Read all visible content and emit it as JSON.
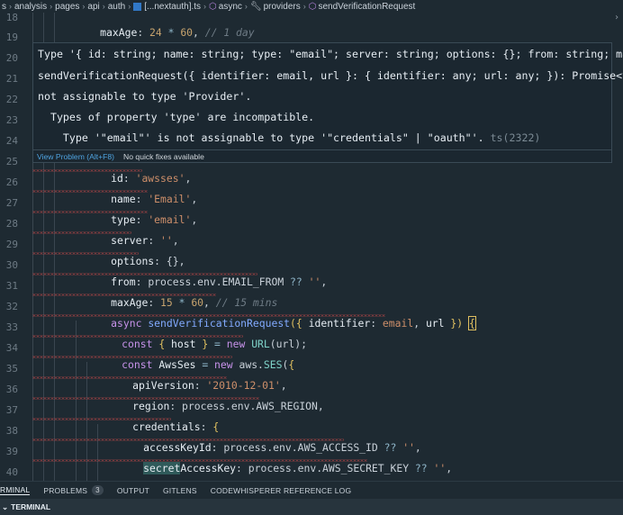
{
  "breadcrumb": {
    "items": [
      "analysis",
      "pages",
      "api",
      "auth",
      "[...nextauth].ts",
      "async",
      "providers",
      "sendVerificationRequest"
    ],
    "first_prefix": "s"
  },
  "editor": {
    "line_numbers": [
      "18",
      "19",
      "20",
      "21",
      "22",
      "23",
      "24",
      "25",
      "26",
      "27",
      "28",
      "29",
      "30",
      "31",
      "32",
      "33",
      "34",
      "35",
      "36",
      "37",
      "38",
      "39",
      "40"
    ],
    "top_line": {
      "prop": "maxAge",
      "rest_a": ": ",
      "n1": "24",
      "op1": " * ",
      "n2": "60",
      "comma": ", ",
      "comment": "// 1 day"
    },
    "lines": {
      "l25": {
        "prop": "id",
        "colon": ": ",
        "str": "'awsses'",
        "comma": ","
      },
      "l26": {
        "prop": "name",
        "colon": ": ",
        "str": "'Email'",
        "comma": ","
      },
      "l27": {
        "prop": "type",
        "colon": ": ",
        "str": "'email'",
        "comma": ","
      },
      "l28": {
        "prop": "server",
        "colon": ": ",
        "str": "''",
        "comma": ","
      },
      "l29": {
        "prop": "options",
        "colon": ": ",
        "rest": "{},"
      },
      "l30": {
        "prop": "from",
        "colon": ": ",
        "rest": "process.env.EMAIL_FROM",
        "op": " ?? ",
        "str": "''",
        "comma": ","
      },
      "l31": {
        "prop": "maxAge",
        "colon": ": ",
        "n1": "15",
        "op": " * ",
        "n2": "60",
        "comma": ", ",
        "comment": "// 15 mins"
      },
      "l32": {
        "kw": "async ",
        "fn": "sendVerificationRequest",
        "p1": "({ ",
        "a1": "identifier",
        "c1": ": ",
        "a2": "email",
        "c2": ", ",
        "a3": "url",
        "p2": " }) ",
        "brace": "{"
      },
      "l33": {
        "kw": "const ",
        "p1": "{ ",
        "v1": "host",
        "p2": " } ",
        "op": "= ",
        "kw2": "new ",
        "cls": "URL",
        "rest": "(url);"
      },
      "l34": {
        "kw": "const ",
        "v1": "AwsSes",
        "op": " = ",
        "kw2": "new ",
        "rest1": "aws.",
        "cls": "SES",
        "rest2": "(",
        "brace": "{"
      },
      "l35": {
        "prop": "apiVersion",
        "colon": ": ",
        "str": "'2010-12-01'",
        "comma": ","
      },
      "l36": {
        "prop": "region",
        "colon": ": ",
        "rest": "process.env.AWS_REGION,"
      },
      "l37": {
        "prop": "credentials",
        "colon": ": ",
        "brace": "{"
      },
      "l38": {
        "prop": "accessKeyId",
        "colon": ": ",
        "rest": "process.env.AWS_ACCESS_ID",
        "op": " ?? ",
        "str": "''",
        "comma": ","
      },
      "l39": {
        "prop_hl": "secret",
        "prop": "AccessKey",
        "colon": ": ",
        "rest": "process.env.AWS_SECRET_KEY",
        "op": " ?? ",
        "str": "''",
        "comma": ","
      },
      "l40": {
        "rest": "},"
      }
    }
  },
  "hover": {
    "line1": "Type '{ id: string; name: string; type: \"email\"; server: string; options: {}; from: string; maxAge: number;",
    "line2": "sendVerificationRequest({ identifier: email, url }: { identifier: any; url: any; }): Promise<void>; }' is",
    "line3": "not assignable to type 'Provider'.",
    "line4": "  Types of property 'type' are incompatible.",
    "line5": "    Type '\"email\"' is not assignable to type '\"credentials\" | \"oauth\"'.",
    "error_code": " ts(2322)",
    "view_problem": "View Problem (Alt+F8)",
    "no_fixes": "No quick fixes available"
  },
  "panel": {
    "tabs": [
      {
        "label": "RMINAL"
      },
      {
        "label": "PROBLEMS",
        "badge": "3"
      },
      {
        "label": "OUTPUT"
      },
      {
        "label": "GITLENS"
      },
      {
        "label": "CODEWHISPERER REFERENCE LOG"
      }
    ],
    "terminal_label": "TERMINAL",
    "terminal_chevron": "⌄"
  },
  "colors": {
    "error_squiggle": "#d14a4a",
    "ts_icon": "#3178c6",
    "link": "#4fa3e0"
  }
}
